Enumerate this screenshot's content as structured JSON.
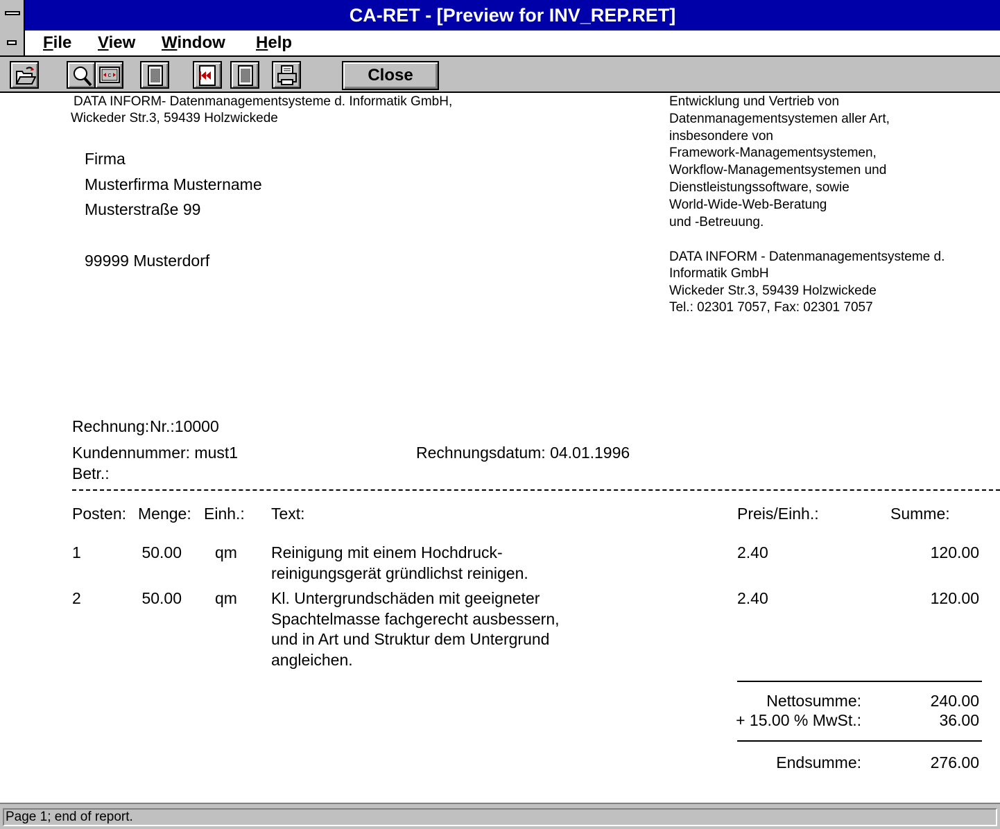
{
  "window": {
    "title": "CA-RET - [Preview for INV_REP.RET]"
  },
  "menu": {
    "items": [
      "File",
      "View",
      "Window",
      "Help"
    ]
  },
  "toolbar": {
    "icons": [
      "open-icon",
      "zoom-icon",
      "fit-page-icon",
      "page-icon",
      "first-page-icon",
      "next-page-icon",
      "printer-icon"
    ],
    "close_label": "Close"
  },
  "report": {
    "sender_line1": "DATA INFORM- Datenmanagementsysteme d. Informatik GmbH,",
    "sender_line2": "Wickeder Str.3, 59439 Holzwickede",
    "recipient": [
      "Firma",
      "Musterfirma Mustername",
      "Musterstraße 99",
      "99999 Musterdorf"
    ],
    "company_desc": [
      "Entwicklung und Vertrieb von",
      "Datenmanagementsystemen aller Art,",
      "insbesondere von",
      "Framework-Managementsystemen,",
      "Workflow-Managementsystemen und",
      "Dienstleistungssoftware, sowie",
      "World-Wide-Web-Beratung",
      "und -Betreuung."
    ],
    "company_contact": [
      "DATA INFORM - Datenmanagementsysteme d.",
      "Informatik GmbH",
      "Wickeder Str.3, 59439 Holzwickede",
      "Tel.: 02301 7057, Fax: 02301 7057"
    ],
    "invoice_label": "Rechnung:",
    "invoice_no": "Nr.:10000",
    "customer_label": "Kundennummer: must1",
    "date_label": "Rechnungsdatum: 04.01.1996",
    "betr_label": "Betr.:",
    "columns": {
      "posten": "Posten:",
      "menge": "Menge:",
      "einh": "Einh.:",
      "text": "Text:",
      "preis": "Preis/Einh.:",
      "summe": "Summe:"
    },
    "items": [
      {
        "pos": "1",
        "menge": "50.00",
        "einh": "qm",
        "text1": "Reinigung mit einem Hochdruck-",
        "text2": "reinigungsgerät gründlichst reinigen.",
        "preis": "2.40",
        "summe": "120.00"
      },
      {
        "pos": "2",
        "menge": "50.00",
        "einh": "qm",
        "text1": "Kl. Untergrundschäden mit geeigneter",
        "text2": "Spachtelmasse fachgerecht ausbessern,",
        "text3": "und in Art und Struktur dem Untergrund",
        "text4": "angleichen.",
        "preis": "2.40",
        "summe": "120.00"
      }
    ],
    "netto_label": "Nettosumme:",
    "netto_value": "240.00",
    "mwst_label": "+ 15.00 % MwSt.:",
    "mwst_value": "36.00",
    "end_label": "Endsumme:",
    "end_value": "276.00"
  },
  "status": {
    "text": "Page 1; end of report."
  },
  "colors": {
    "titlebar": "#0000a8",
    "chrome": "#c0c0c0"
  }
}
